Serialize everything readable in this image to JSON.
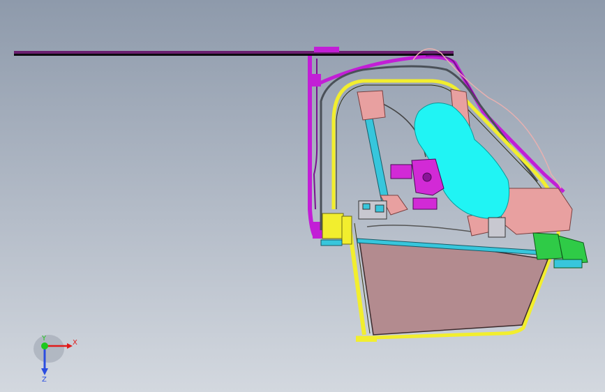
{
  "triad": {
    "x_label": "X",
    "y_label": "Y",
    "z_label": "Z"
  },
  "colors": {
    "frame_magenta": "#c21ed6",
    "rail_yellow": "#f2ee2e",
    "glass": "#b38b8f",
    "guide_cyan": "#37c6dc",
    "bracket_pink": "#e8a0a0",
    "cushion_cyan": "#20f4f4",
    "motor_purple": "#d22ad6",
    "connector_green": "#2fcb47",
    "cable_pink": "#e8b0b0",
    "axis_x": "#e01a1a",
    "axis_y": "#1ec81e",
    "axis_z": "#2a4de0"
  }
}
